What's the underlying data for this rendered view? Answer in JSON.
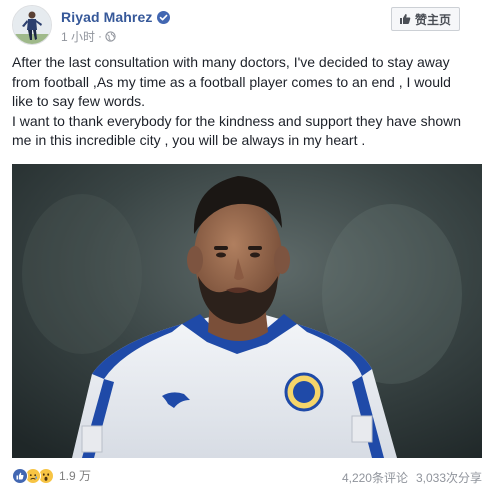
{
  "post": {
    "author": "Riyad Mahrez",
    "timestamp": "1 小时",
    "audience_icon": "globe-icon",
    "like_page_label": "赞主页",
    "paragraphs": [
      "After the last consultation with many doctors, I've decided to stay away from football ,As my time as a football player comes to an end , I would like to say few words.",
      "I want to thank everybody for the kindness and support they have shown me in this incredible city , you will be always in my heart ."
    ]
  },
  "footer": {
    "reaction_icons": [
      "like-reaction-icon",
      "sad-reaction-icon",
      "wow-reaction-icon"
    ],
    "reaction_count": "1.9 万",
    "comments": "4,220条评论",
    "shares": "3,033次分享"
  },
  "colors": {
    "name_blue": "#365899",
    "verified_blue": "#4267b2",
    "meta_gray": "#90949c",
    "like_blue": "#4267b2",
    "reaction_yellow": "#f7c444"
  }
}
